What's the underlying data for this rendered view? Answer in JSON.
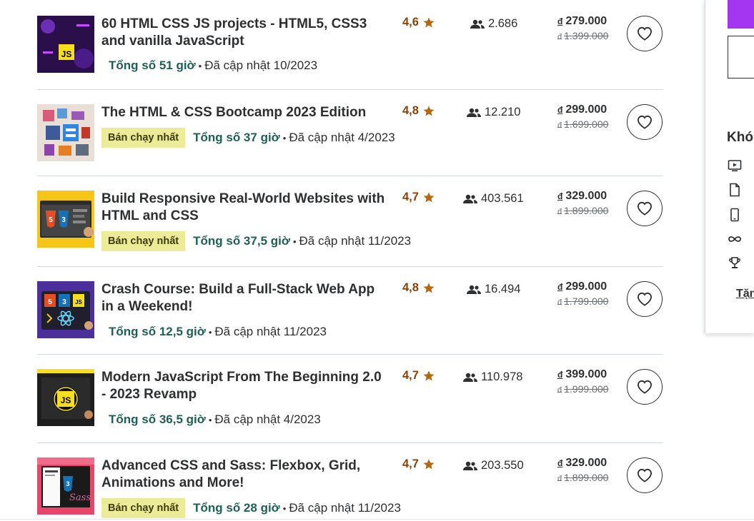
{
  "courses": [
    {
      "title": "60 HTML CSS JS projects - HTML5, CSS3 and vanilla JavaScript",
      "badge": "",
      "hours": "Tổng số 51 giờ",
      "updated": "Đã cập nhật 10/2023",
      "rating": "4,6",
      "learners": "2.686",
      "price_currency": "đ",
      "price": "279.000",
      "old_price": "1.399.000"
    },
    {
      "title": "The HTML & CSS Bootcamp 2023 Edition",
      "badge": "Bán chạy nhất",
      "hours": "Tổng số 37 giờ",
      "updated": "Đã cập nhật 4/2023",
      "rating": "4,8",
      "learners": "12.210",
      "price_currency": "đ",
      "price": "299.000",
      "old_price": "1.699.000"
    },
    {
      "title": "Build Responsive Real-World Websites with HTML and CSS",
      "badge": "Bán chạy nhất",
      "hours": "Tổng số 37,5 giờ",
      "updated": "Đã cập nhật 11/2023",
      "rating": "4,7",
      "learners": "403.561",
      "price_currency": "đ",
      "price": "329.000",
      "old_price": "1.899.000"
    },
    {
      "title": "Crash Course: Build a Full-Stack Web App in a Weekend!",
      "badge": "",
      "hours": "Tổng số 12,5 giờ",
      "updated": "Đã cập nhật 11/2023",
      "rating": "4,8",
      "learners": "16.494",
      "price_currency": "đ",
      "price": "299.000",
      "old_price": "1.799.000"
    },
    {
      "title": "Modern JavaScript From The Beginning 2.0 - 2023 Revamp",
      "badge": "",
      "hours": "Tổng số 36,5 giờ",
      "updated": "Đã cập nhật 4/2023",
      "rating": "4,7",
      "learners": "110.978",
      "price_currency": "đ",
      "price": "399.000",
      "old_price": "1.999.000"
    },
    {
      "title": "Advanced CSS and Sass: Flexbox, Grid, Animations and More!",
      "badge": "Bán chạy nhất",
      "hours": "Tổng số 28 giờ",
      "updated": "Đã cập nhật 11/2023",
      "rating": "4,7",
      "learners": "203.550",
      "price_currency": "đ",
      "price": "329.000",
      "old_price": "1.899.000"
    }
  ],
  "sidebar": {
    "heading": "Khó",
    "icons": [
      "video-icon",
      "file-icon",
      "mobile-icon",
      "infinity-icon",
      "trophy-icon"
    ],
    "gift_link": "Tặn"
  },
  "colors": {
    "accent": "#a435f0",
    "rating": "#8b4309",
    "hours": "#1e6055",
    "badge": "#eceb98"
  }
}
